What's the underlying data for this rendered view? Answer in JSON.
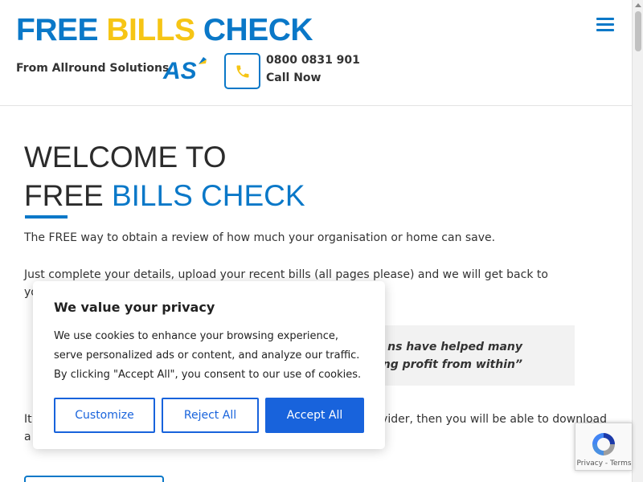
{
  "header": {
    "logo_part1": "FREE",
    "logo_part2": "BILLS",
    "logo_part3": "CHECK",
    "tagline": "From Allround Solutions",
    "as_logo_text": "AS",
    "phone_number": "0800 0831 901",
    "call_now": "Call Now"
  },
  "main": {
    "headline_line1": "WELCOME TO",
    "headline_line2_part1": "FREE ",
    "headline_line2_part2": "BILLS CHECK",
    "paragraph1": "The FREE way to obtain a review of how much your organisation or home can save.",
    "paragraph2": "Just complete your details, upload your recent bills (all pages please) and we will get back to you…..It’s th",
    "quote_line1": "ns have helped many",
    "quote_line2": "ating profit from within”",
    "paragraph3_start": "It",
    "paragraph3_end": "ovider, then you will be able to download",
    "paragraph3_line2": "a"
  },
  "cookie_banner": {
    "title": "We value your privacy",
    "body": "We use cookies to enhance your browsing experience, serve personalized ads or content, and analyze our traffic. By clicking \"Accept All\", you consent to our use of cookies.",
    "customize_label": "Customize",
    "reject_label": "Reject All",
    "accept_label": "Accept All"
  },
  "recaptcha": {
    "links": "Privacy - Terms"
  },
  "colors": {
    "brand_blue": "#0a78c8",
    "brand_yellow": "#f6c515",
    "cookie_blue": "#1863dc",
    "quote_bg": "#f2f2f2"
  },
  "icons": {
    "menu": "hamburger-menu-icon",
    "phone": "phone-icon",
    "recaptcha": "recaptcha-icon"
  }
}
